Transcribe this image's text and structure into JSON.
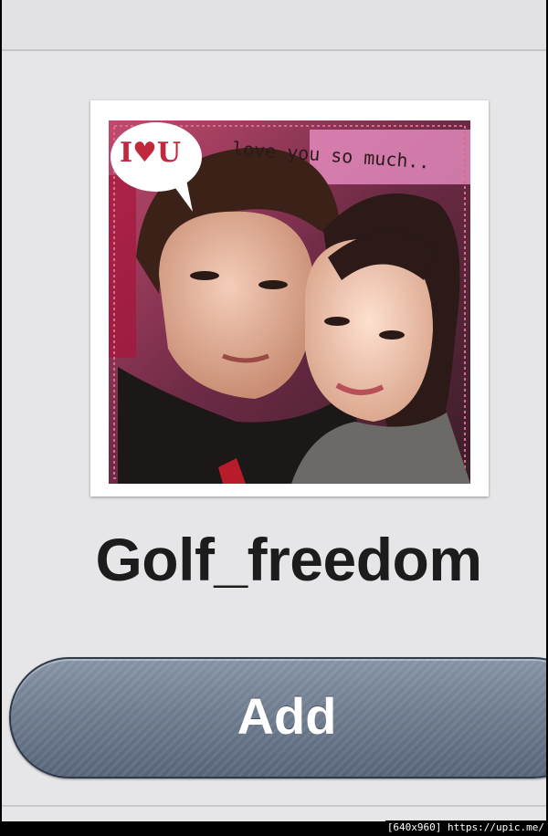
{
  "profile": {
    "photo_caption_badge": "I♥U",
    "photo_caption_text": "love you so much..",
    "username": "Golf_freedom"
  },
  "actions": {
    "add_label": "Add"
  },
  "watermark": {
    "text": "[640x960] https://upic.me/"
  },
  "colors": {
    "background": "#e6e6e8",
    "button_top": "#8693a4",
    "button_bottom": "#56647a",
    "badge_red": "#c0283c"
  }
}
